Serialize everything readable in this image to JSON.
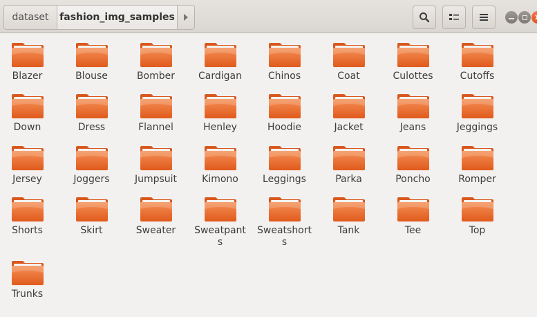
{
  "breadcrumb": {
    "items": [
      "dataset",
      "fashion_img_samples"
    ]
  },
  "header": {
    "search_icon": "search-icon",
    "view_icon": "view-options-icon",
    "menu_icon": "hamburger-menu-icon"
  },
  "window_controls": {
    "minimize_icon": "minimize-icon",
    "maximize_icon": "maximize-icon",
    "close_icon": "close-icon"
  },
  "colors": {
    "folder_orange": "#f07a3a",
    "folder_tab": "#e2632a",
    "close_button": "#e95420"
  },
  "folders": [
    "Blazer",
    "Blouse",
    "Bomber",
    "Cardigan",
    "Chinos",
    "Coat",
    "Culottes",
    "Cutoffs",
    "Down",
    "Dress",
    "Flannel",
    "Henley",
    "Hoodie",
    "Jacket",
    "Jeans",
    "Jeggings",
    "Jersey",
    "Joggers",
    "Jumpsuit",
    "Kimono",
    "Leggings",
    "Parka",
    "Poncho",
    "Romper",
    "Shorts",
    "Skirt",
    "Sweater",
    "Sweatpants",
    "Sweatshorts",
    "Tank",
    "Tee",
    "Top",
    "Trunks"
  ]
}
